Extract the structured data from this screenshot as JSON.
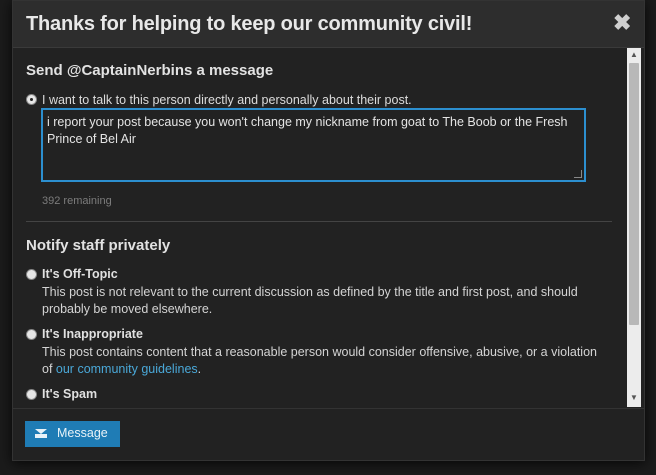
{
  "dialog": {
    "title": "Thanks for helping to keep our community civil!",
    "close_label": "✖"
  },
  "message_section": {
    "heading": "Send @CaptainNerbins a message",
    "option_label": "I want to talk to this person directly and personally about their post.",
    "option_selected": true,
    "textarea_value": "i report your post because you won't change my nickname from goat to The Boob or the Fresh Prince of Bel Air",
    "remaining": "392 remaining"
  },
  "staff_section": {
    "heading": "Notify staff privately",
    "options": [
      {
        "title": "It's Off-Topic",
        "description": "This post is not relevant to the current discussion as defined by the title and first post, and should probably be moved elsewhere.",
        "selected": false
      },
      {
        "title": "It's Inappropriate",
        "description_prefix": "This post contains content that a reasonable person would consider offensive, abusive, or a violation of ",
        "link_text": "our community guidelines",
        "description_suffix": ".",
        "selected": false
      },
      {
        "title": "It's Spam",
        "selected": false
      }
    ]
  },
  "footer": {
    "button_label": "Message",
    "button_icon": "envelope-icon"
  },
  "colors": {
    "accent": "#1f7cb5",
    "link": "#4aa8d8",
    "focus_border": "#2c8fcf"
  }
}
